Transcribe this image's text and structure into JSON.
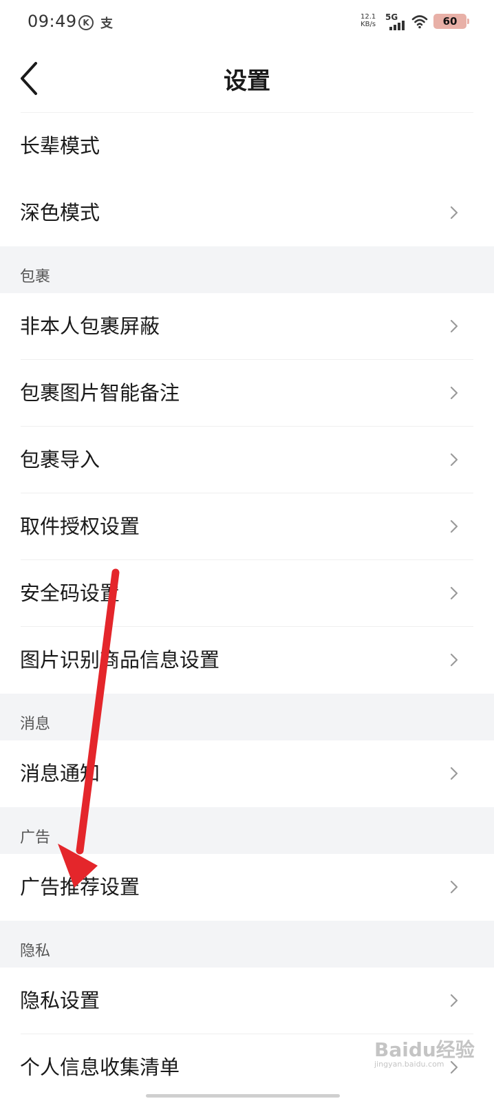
{
  "status_bar": {
    "time": "09:49",
    "k_badge": "K",
    "alipay_glyph": "支",
    "speed_value": "12.1",
    "speed_unit": "KB/s",
    "network": "5G",
    "battery": "60"
  },
  "nav": {
    "title": "设置"
  },
  "items": {
    "elder_mode": "长辈模式",
    "dark_mode": "深色模式",
    "section_package": "包裹",
    "block_package": "非本人包裹屏蔽",
    "package_image_note": "包裹图片智能备注",
    "package_import": "包裹导入",
    "pickup_auth": "取件授权设置",
    "security_code": "安全码设置",
    "image_recognition": "图片识别商品信息设置",
    "section_message": "消息",
    "message_notify": "消息通知",
    "section_ad": "广告",
    "ad_recommend": "广告推荐设置",
    "section_privacy": "隐私",
    "privacy_settings": "隐私设置",
    "personal_info_list": "个人信息收集清单"
  },
  "watermark": {
    "brand": "Baidu经验",
    "sub": "jingyan.baidu.com"
  },
  "colors": {
    "section_bg": "#f3f4f6",
    "annotation_arrow": "#e4262b",
    "battery_bg": "#e8b0a7"
  }
}
